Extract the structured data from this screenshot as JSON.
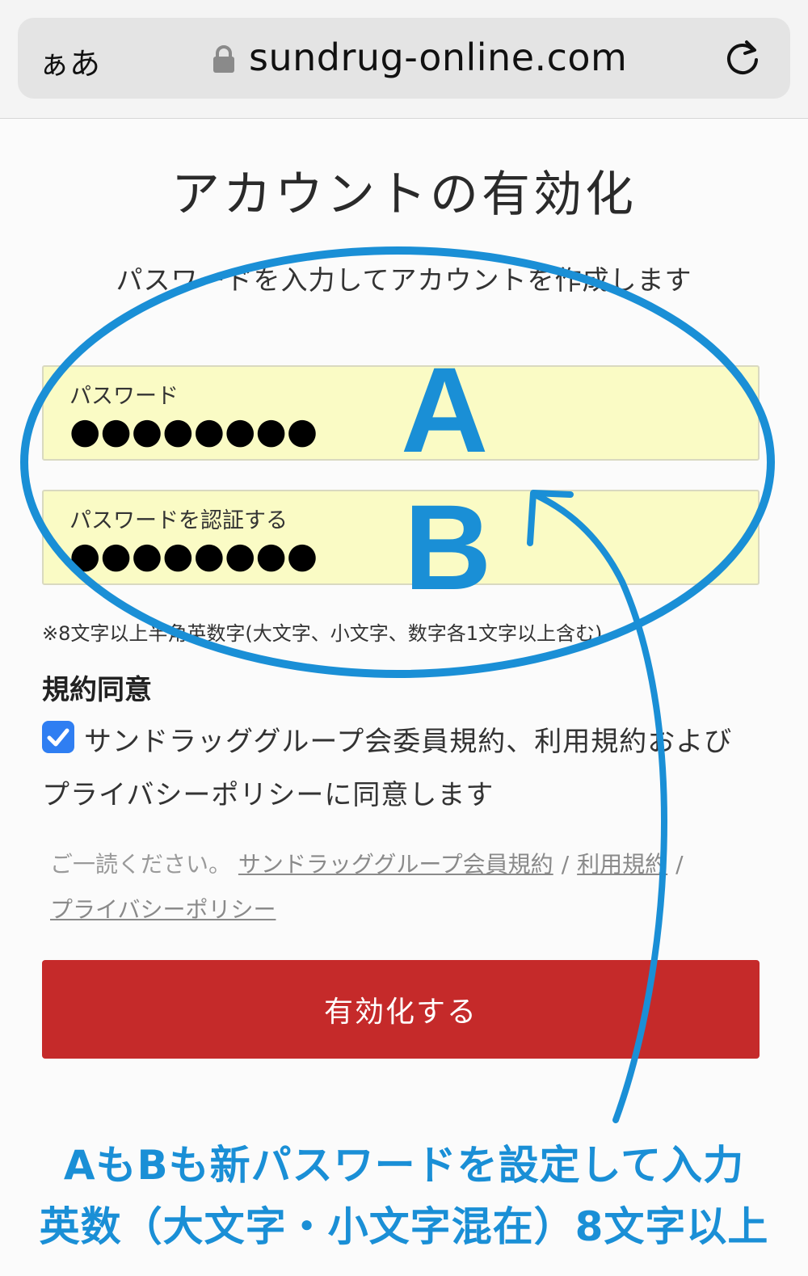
{
  "browser": {
    "text_size_label": "ぁあ",
    "url": "sundrug-online.com"
  },
  "page": {
    "title": "アカウントの有効化",
    "lead": "パスワードを入力してアカウントを作成します"
  },
  "form": {
    "password_label": "パスワード",
    "password_value": "●●●●●●●●",
    "confirm_label": "パスワードを認証する",
    "confirm_value": "●●●●●●●●",
    "hint": "※8文字以上半角英数字(大文字、小文字、数字各1文字以上含む)",
    "agreement_heading": "規約同意",
    "agreement_checked": true,
    "agreement_line1": "サンドラッググループ会委員規約、利用規約および",
    "agreement_line2": "プライバシーポリシーに同意します",
    "read_prompt": "ご一読ください。",
    "link_member_terms": "サンドラッググループ会員規約",
    "link_terms": "利用規約",
    "link_privacy": "プライバシーポリシー",
    "link_separator": "/",
    "submit_label": "有効化する"
  },
  "annotation": {
    "letter_a": "A",
    "letter_b": "B",
    "caption_line1": "AもBも新パスワードを設定して入力",
    "caption_line2": "英数（大文字・小文字混在）8文字以上",
    "color": "#1a8fd6"
  }
}
